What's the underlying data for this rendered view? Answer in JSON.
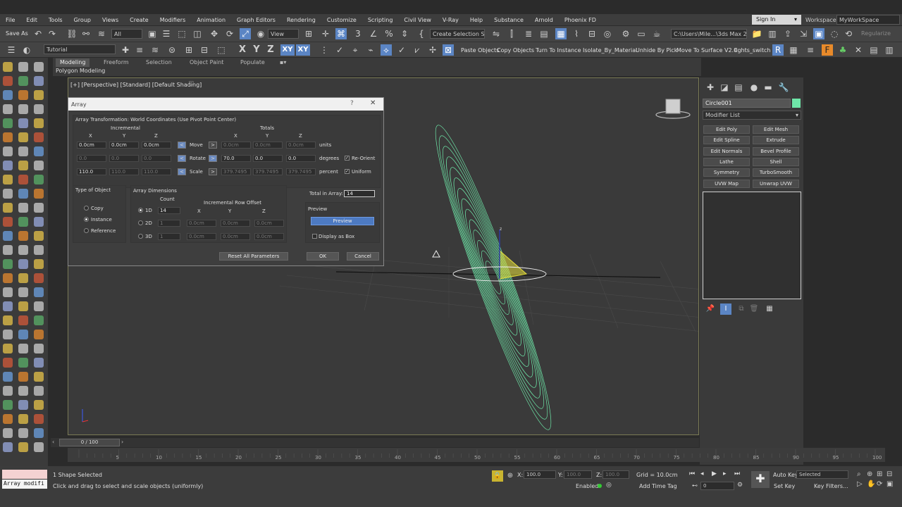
{
  "menu": {
    "items": [
      "File",
      "Edit",
      "Tools",
      "Group",
      "Views",
      "Create",
      "Modifiers",
      "Animation",
      "Graph Editors",
      "Rendering",
      "Customize",
      "Scripting",
      "Civil View",
      "V-Ray",
      "Help",
      "Substance",
      "Arnold",
      "Phoenix FD"
    ],
    "sign_in": "Sign In",
    "workspace_label": "Workspaces:",
    "workspace_value": "MyWorkSpace"
  },
  "toolbar1": {
    "save_as": "Save As",
    "selection_filter": "All",
    "ref_coord": "View",
    "named_selection": "Create Selection Se",
    "path": "C:\\Users\\Mile...\\3ds Max 2023",
    "regularize": "Regularize"
  },
  "toolbar2": {
    "layer": "Tutorial",
    "axis_x": "X",
    "axis_y": "Y",
    "axis_z": "Z",
    "axis_xy": "XY",
    "axis_xy2": "XY",
    "scripts": [
      "Paste Objects",
      "Copy Objects",
      "Turn To Instance",
      "Isolate_By_Material",
      "Unhide By Pick",
      "Move To Surface V2.0",
      "lights_switch"
    ]
  },
  "ribbon": {
    "tabs": [
      "Modeling",
      "Freeform",
      "Selection",
      "Object Paint",
      "Populate"
    ],
    "sub": "Polygon Modeling"
  },
  "viewport": {
    "label": "[+] [Perspective] [Standard] [Default Shading]"
  },
  "command_panel": {
    "object_name": "Circle001",
    "modifier_list": "Modifier List",
    "buttons": [
      "Edit Poly",
      "Edit Mesh",
      "Edit Spline",
      "Extrude",
      "Edit Normals",
      "Bevel Profile",
      "Lathe",
      "Shell",
      "Symmetry",
      "TurboSmooth",
      "UVW Map",
      "Unwrap UVW"
    ]
  },
  "dialog": {
    "title": "Array",
    "help": "?",
    "close": "✕",
    "header": "Array Transformation: World Coordinates (Use Pivot Point Center)",
    "incremental": "Incremental",
    "totals": "Totals",
    "col_x": "X",
    "col_y": "Y",
    "col_z": "Z",
    "rows": {
      "move": {
        "label": "Move",
        "unit": "units",
        "inc": [
          "0.0cm",
          "0.0cm",
          "0.0cm"
        ],
        "tot": [
          "0.0cm",
          "0.0cm",
          "0.0cm"
        ]
      },
      "rotate": {
        "label": "Rotate",
        "unit": "degrees",
        "inc": [
          "0.0",
          "0.0",
          "0.0"
        ],
        "tot": [
          "70.0",
          "0.0",
          "0.0"
        ],
        "opt": "Re-Orient"
      },
      "scale": {
        "label": "Scale",
        "unit": "percent",
        "inc": [
          "110.0",
          "110.0",
          "110.0"
        ],
        "tot": [
          "379.7495",
          "379.7495",
          "379.7495"
        ],
        "opt": "Uniform"
      }
    },
    "type_of_object": {
      "title": "Type of Object",
      "options": [
        "Copy",
        "Instance",
        "Reference"
      ],
      "selected": "Instance"
    },
    "array_dimensions": {
      "title": "Array Dimensions",
      "count_label": "Count",
      "offset_label": "Incremental Row Offset",
      "dims": [
        {
          "label": "1D",
          "count": "14",
          "x": "",
          "y": "",
          "z": ""
        },
        {
          "label": "2D",
          "count": "1",
          "x": "0.0cm",
          "y": "0.0cm",
          "z": "0.0cm"
        },
        {
          "label": "3D",
          "count": "1",
          "x": "0.0cm",
          "y": "0.0cm",
          "z": "0.0cm"
        }
      ]
    },
    "total_label": "Total in Array:",
    "total_value": "14",
    "preview_title": "Preview",
    "preview_button": "Preview",
    "display_as_box": "Display as Box",
    "reset": "Reset All Parameters",
    "ok": "OK",
    "cancel": "Cancel"
  },
  "timeline": {
    "slider": "0 / 100",
    "ticks": [
      "5",
      "10",
      "15",
      "20",
      "25",
      "30",
      "35",
      "40",
      "45",
      "50",
      "55",
      "60",
      "65",
      "70",
      "75",
      "80",
      "85",
      "90",
      "95",
      "100"
    ]
  },
  "status": {
    "maxscript": "Array modifi",
    "selected": "1 Shape Selected",
    "prompt": "Click and drag to select and scale objects (uniformly)",
    "x_label": "X:",
    "x_value": "100.0",
    "y_label": "Y:",
    "y_value": "100.0",
    "z_label": "Z:",
    "z_value": "100.0",
    "grid": "Grid = 10.0cm",
    "enabled": "Enabled:",
    "add_time_tag": "Add Time Tag",
    "auto_key": "Auto Key",
    "set_key": "Set Key",
    "selected_sel": "Selected",
    "key_filters": "Key Filters...",
    "frame": "0"
  },
  "colors": {
    "accent": "#5b85c4",
    "wire_green": "#6ee7a8",
    "wire_yellow": "#e8e03a"
  }
}
